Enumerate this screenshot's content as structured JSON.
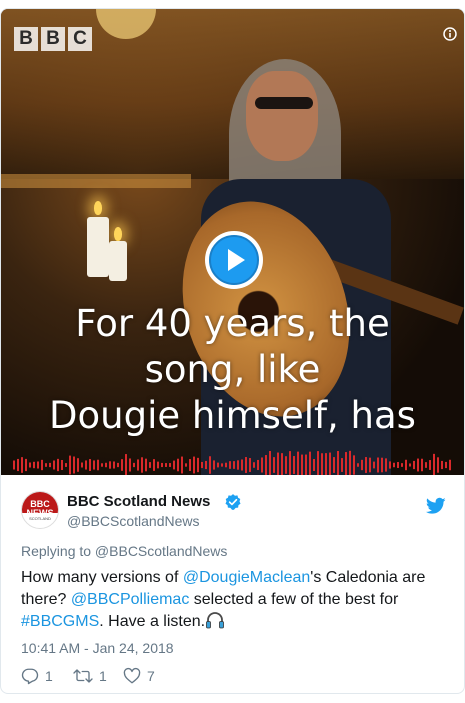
{
  "video": {
    "logo_letters": [
      "B",
      "B",
      "C"
    ],
    "caption_lines": [
      "For 40 years, the",
      "song, like",
      "Dougie himself, has"
    ],
    "icons": {
      "info": "info-icon",
      "play": "play-icon"
    },
    "accent_color": "#d9292b"
  },
  "tweet": {
    "avatar_text": "BBC",
    "avatar_subtext": "NEWS",
    "avatar_caption": "SCOTLAND",
    "display_name": "BBC Scotland News",
    "screen_name": "@BBCScotlandNews",
    "reply_context": "Replying to @BBCScotlandNews",
    "text_parts": {
      "p1": "How many versions of ",
      "mention1": "@DougieMaclean",
      "p2": "'s Caledonia are there? ",
      "mention2": "@BBCPolliemac",
      "p3": " selected a few of the best for ",
      "hashtag": "#BBCGMS",
      "p4": ". Have a listen."
    },
    "timestamp": "10:41 AM - Jan 24, 2018",
    "reply_count": "1",
    "retweet_count": "1",
    "like_count": "7",
    "link_color": "#1b95e0",
    "verified_color": "#1da1f2"
  }
}
